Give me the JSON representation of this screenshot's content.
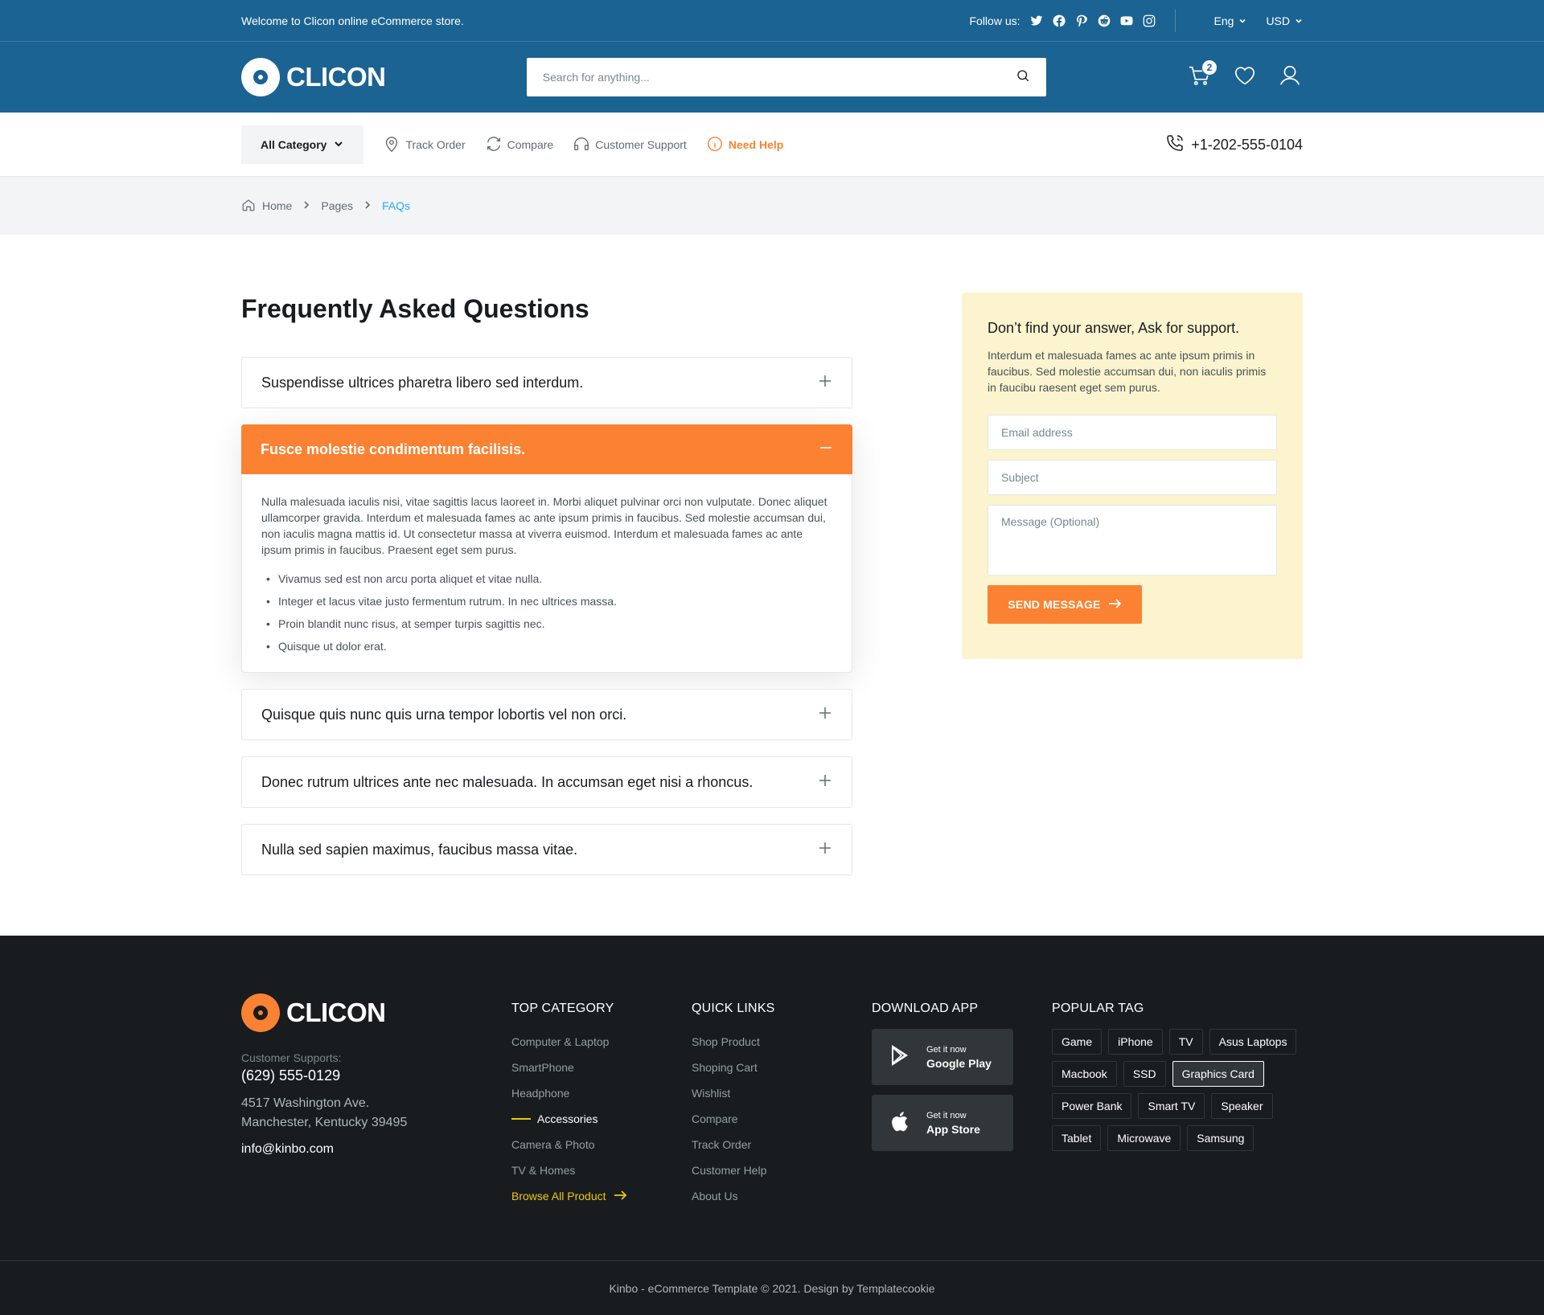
{
  "topbar": {
    "welcome": "Welcome to Clicon online eCommerce store.",
    "follow_label": "Follow us:",
    "social_icons": [
      "twitter-icon",
      "facebook-icon",
      "pinterest-icon",
      "reddit-icon",
      "youtube-icon",
      "instagram-icon"
    ],
    "language": "Eng",
    "currency": "USD"
  },
  "header": {
    "logo_text": "CLICON",
    "search_placeholder": "Search for anything...",
    "cart_count": "2"
  },
  "nav": {
    "all_category": "All Category",
    "links": [
      "Track Order",
      "Compare",
      "Customer Support",
      "Need Help"
    ],
    "phone": "+1-202-555-0104"
  },
  "breadcrumb": [
    "Home",
    "Pages",
    "FAQs"
  ],
  "faq": {
    "title": "Frequently Asked Questions",
    "items": [
      {
        "question": "Suspendisse ultrices pharetra libero sed interdum.",
        "open": false
      },
      {
        "question": "Fusce molestie condimentum facilisis.",
        "open": true,
        "answer": "Nulla malesuada iaculis nisi, vitae sagittis lacus laoreet in. Morbi aliquet pulvinar orci non vulputate. Donec aliquet ullamcorper gravida. Interdum et malesuada fames ac ante ipsum primis in faucibus. Sed molestie accumsan dui, non iaculis magna mattis id. Ut consectetur massa at viverra euismod. Interdum et malesuada fames ac ante ipsum primis in faucibus. Praesent eget sem purus.",
        "bullets": [
          "Vivamus sed est non arcu porta aliquet et vitae nulla.",
          "Integer et lacus vitae justo fermentum rutrum. In nec ultrices massa.",
          "Proin blandit nunc risus, at semper turpis sagittis nec.",
          "Quisque ut dolor erat."
        ]
      },
      {
        "question": "Quisque quis nunc quis urna tempor lobortis vel non orci.",
        "open": false
      },
      {
        "question": "Donec rutrum ultrices ante nec malesuada. In accumsan eget nisi a rhoncus.",
        "open": false
      },
      {
        "question": "Nulla sed sapien maximus, faucibus massa vitae.",
        "open": false
      }
    ]
  },
  "support": {
    "title": "Don’t find your answer, Ask for support.",
    "text": "Interdum et malesuada fames ac ante ipsum primis in faucibus. Sed molestie accumsan dui, non iaculis primis in faucibu raesent eget sem purus.",
    "email_placeholder": "Email address",
    "subject_placeholder": "Subject",
    "message_placeholder": "Message (Optional)",
    "button": "SEND MESSAGE"
  },
  "footer": {
    "logo_text": "CLICON",
    "support_label": "Customer Supports:",
    "phone": "(629) 555-0129",
    "address_line1": "4517 Washington Ave.",
    "address_line2": "Manchester, Kentucky 39495",
    "email": "info@kinbo.com",
    "top_category": {
      "title": "TOP CATEGORY",
      "links": [
        "Computer & Laptop",
        "SmartPhone",
        "Headphone",
        "Accessories",
        "Camera & Photo",
        "TV & Homes"
      ],
      "browse": "Browse All Product"
    },
    "quick_links": {
      "title": "QUICK LINKS",
      "links": [
        "Shop Product",
        "Shoping Cart",
        "Wishlist",
        "Compare",
        "Track Order",
        "Customer Help",
        "About Us"
      ]
    },
    "download": {
      "title": "DOWNLOAD APP",
      "google_small": "Get it now",
      "google_big": "Google Play",
      "apple_small": "Get it now",
      "apple_big": "App Store"
    },
    "tags": {
      "title": "POPULAR TAG",
      "items": [
        "Game",
        "iPhone",
        "TV",
        "Asus Laptops",
        "Macbook",
        "SSD",
        "Graphics Card",
        "Power Bank",
        "Smart TV",
        "Speaker",
        "Tablet",
        "Microwave",
        "Samsung"
      ],
      "active": "Graphics Card"
    },
    "copyright": "Kinbo - eCommerce Template © 2021. Design by Templatecookie"
  },
  "colors": {
    "primary": "#1B6392",
    "accent": "#FA8232",
    "support_bg": "#FBF4CE",
    "footer_bg": "#191C1F",
    "highlight": "#EBC80C",
    "link_blue": "#2DA5F3"
  }
}
